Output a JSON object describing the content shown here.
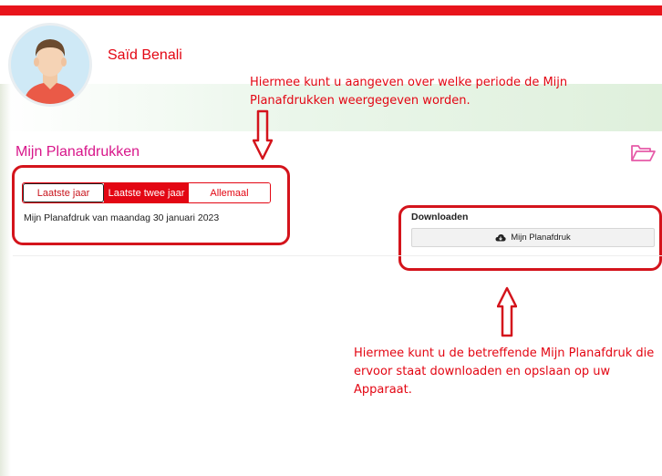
{
  "user": {
    "name": "Saïd Benali"
  },
  "annotations": {
    "top": "Hiermee kunt u aangeven over welke periode de Mijn Planafdrukken weergegeven worden.",
    "bottom": "Hiermee kunt u de betreffende Mijn Planafdruk die ervoor staat downloaden en opslaan op uw Apparaat."
  },
  "panel": {
    "title": "Mijn Planafdrukken",
    "icon": "folder-open-icon",
    "filters": [
      {
        "label": "Laatste jaar"
      },
      {
        "label": "Laatste twee jaar",
        "active": true
      },
      {
        "label": "Allemaal"
      }
    ],
    "planafdruk_text": "Mijn Planafdruk van maandag 30 januari 2023",
    "download": {
      "label": "Downloaden",
      "button_label": "Mijn Planafdruk",
      "button_icon": "cloud-download-icon"
    }
  },
  "colors": {
    "brand": "#e30613",
    "title": "#d8168a",
    "annotation": "#d4141c"
  }
}
